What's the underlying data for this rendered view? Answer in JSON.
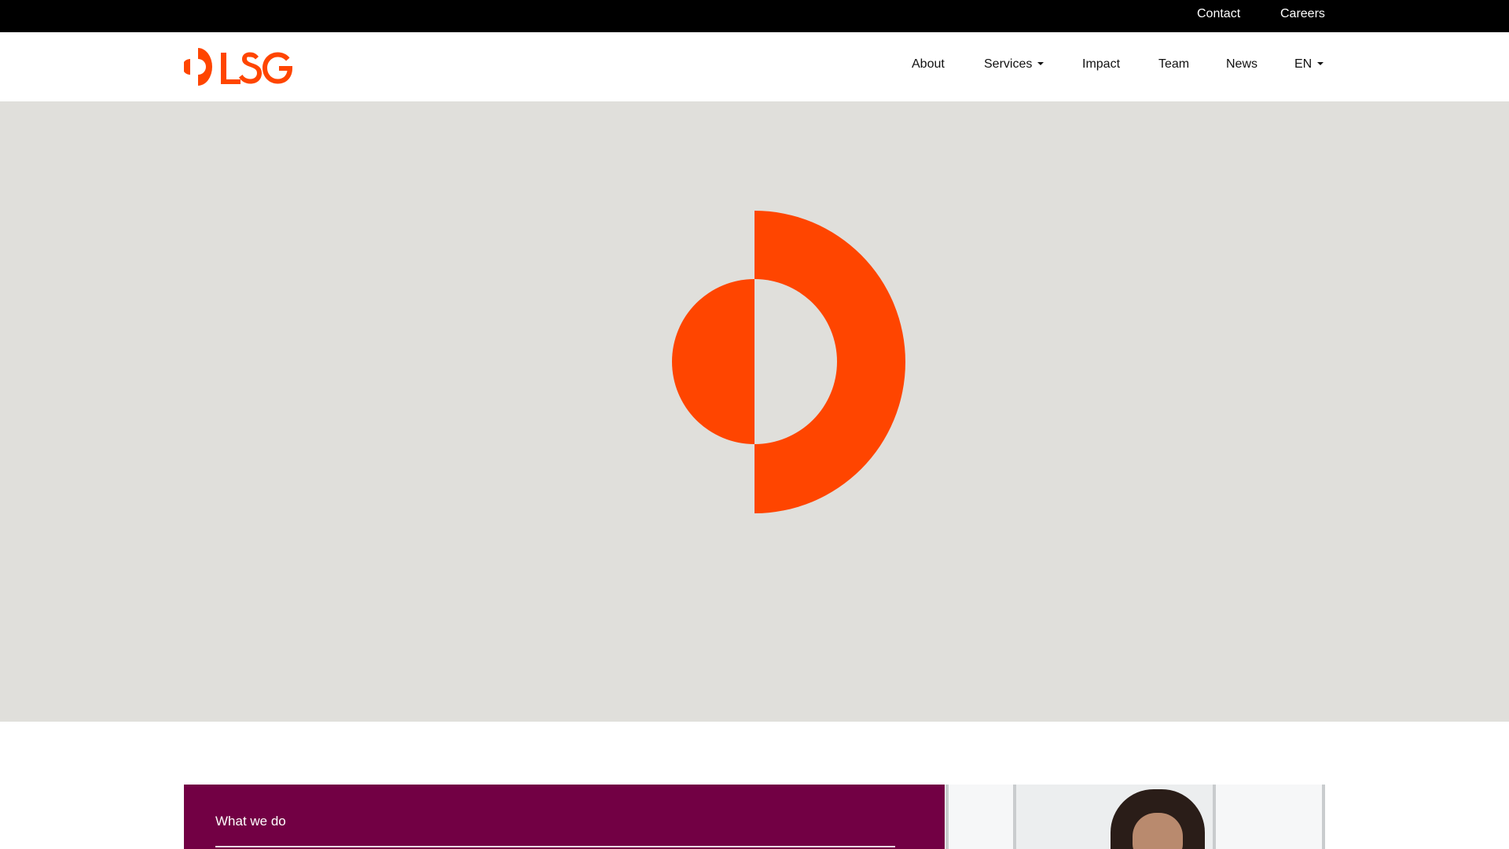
{
  "utility_nav": {
    "contact": "Contact",
    "careers": "Careers"
  },
  "brand": {
    "logo_text": "LSG",
    "accent_color": "#ff4500"
  },
  "main_nav": {
    "about": "About",
    "services": "Services",
    "impact": "Impact",
    "team": "Team",
    "news": "News",
    "language": "EN"
  },
  "hero": {
    "background_color": "#e0dfdb",
    "mark_icon": "lsg-brand-mark-icon"
  },
  "feature": {
    "label": "What we do",
    "panel_color": "#720044"
  }
}
